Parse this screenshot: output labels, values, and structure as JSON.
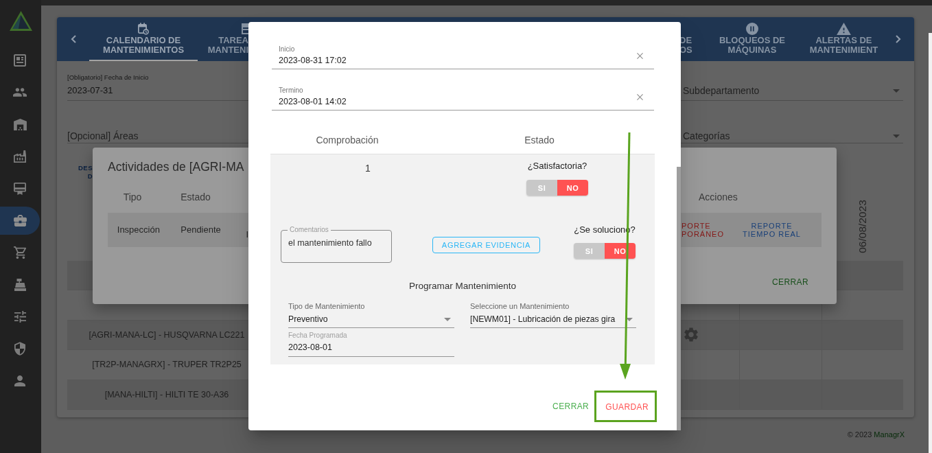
{
  "sidebar": {
    "items": [
      {
        "selected": false
      },
      {
        "selected": false
      },
      {
        "selected": false
      },
      {
        "selected": false
      },
      {
        "selected": false
      },
      {
        "selected": true
      },
      {
        "selected": false
      },
      {
        "selected": false
      },
      {
        "selected": false
      },
      {
        "selected": false
      },
      {
        "selected": false
      }
    ]
  },
  "page": {
    "tabs": [
      {
        "label": "CALENDARIO DE\nMANTENIMIENTOS",
        "selected": true
      },
      {
        "label": "TAREA\nMANTENI",
        "selected": false
      },
      {
        "label": "DE\nOS",
        "selected": false
      },
      {
        "label": "BLOQUEOS DE\nMÁQUINAS",
        "selected": false
      },
      {
        "label": "ALERTAS DE\nMANTENIMIENT",
        "selected": false
      }
    ],
    "filters": [
      {
        "kind": "date",
        "label": "[Obligatorio] Fecha de Inicio",
        "value": "2023-07-31"
      },
      {
        "kind": "select",
        "placeholder": "Subdepartamento"
      },
      {
        "kind": "input",
        "placeholder": "[Opcional] Áreas"
      },
      {
        "kind": "select",
        "placeholder": "Categorías"
      }
    ],
    "link": "DES\nD",
    "date_header": "06/08/2023",
    "table": {
      "rows": [
        {},
        {
          "settings_button": false
        },
        {
          "machine": "[AGRI-MANA-LC] - HUSQVARNA LC221",
          "settings_button": true
        },
        {
          "machine": "[TR2P-MANAGRX] - TRUPER TR2P25",
          "settings_button": false
        },
        {
          "machine": "[MANA-HILTI] - HILTI TE 30-A36",
          "settings_button": false
        }
      ]
    },
    "footer": {
      "copyright": "© 2023",
      "brand": "ManagrX"
    }
  },
  "activities_dialog": {
    "title": "Actividades de [AGRI-MA",
    "columns": [
      "Tipo",
      "Estado",
      "Acciones"
    ],
    "rows": [
      {
        "cells": [
          "Inspección",
          "Pendiente",
          "I"
        ],
        "actions": [
          {
            "label": "PORTE\nPORÁNEO",
            "kind": "danger"
          },
          {
            "label": "REPORTE\nTIEMPO REAL",
            "kind": "primary"
          }
        ]
      }
    ],
    "close_button": "CERRAR"
  },
  "maintenance_dialog": {
    "fields": [
      {
        "label": "Inicio",
        "value": "2023-08-31 17:02"
      },
      {
        "label": "Termino",
        "value": "2023-08-01 14:02"
      }
    ],
    "table": {
      "columns": [
        "Comprobación",
        "Estado"
      ],
      "rows": [
        {
          "number": "1",
          "satisfactory": {
            "question": "¿Satisfactoria?",
            "options": [
              {
                "label": "SI",
                "selected": false
              },
              {
                "label": "NO",
                "selected": true
              }
            ]
          },
          "comments": {
            "label": "Comentarios",
            "value": "el mantenimiento fallo"
          },
          "evidence_button": "AGREGAR EVIDENCIA",
          "solved": {
            "question": "¿Se soluciono?",
            "options": [
              {
                "label": "SI",
                "selected": false
              },
              {
                "label": "NO",
                "selected": true
              }
            ]
          },
          "schedule": {
            "title": "Programar Mantenimiento",
            "fields": [
              {
                "kind": "select",
                "label": "Tipo de Mantenimiento",
                "value": "Preventivo"
              },
              {
                "kind": "select",
                "label": "Seleccione un Mantenimiento",
                "value": "[NEWM01] - Lubricación de piezas gira"
              },
              {
                "kind": "date",
                "label": "Fecha Programada",
                "value": "2023-08-01"
              }
            ]
          }
        }
      ]
    },
    "buttons": [
      {
        "label": "CERRAR",
        "kind": "cancel",
        "highlighted": false
      },
      {
        "label": "GUARDAR",
        "kind": "save",
        "highlighted": true
      }
    ]
  }
}
